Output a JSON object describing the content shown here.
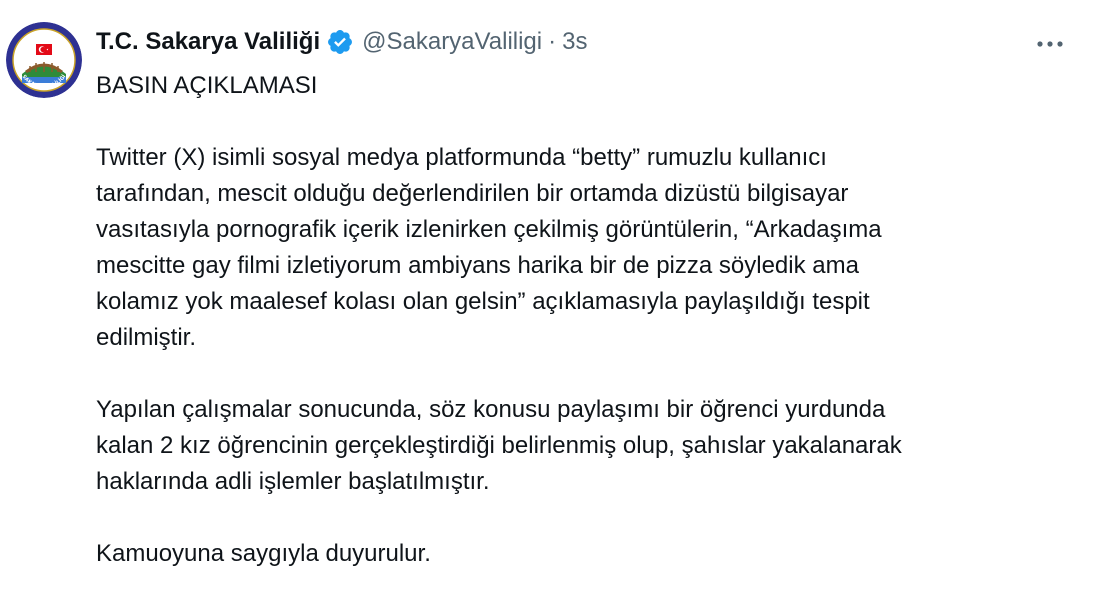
{
  "tweet": {
    "display_name": "T.C. Sakarya Valiliği",
    "handle": "@SakaryaValiligi",
    "separator": "·",
    "time": "3s",
    "avatar_text": {
      "top": "TÜRKİYE CUMHURİYETİ",
      "bottom": "SAKARYA VALİLİĞİ"
    },
    "paragraphs": {
      "p1": "BASIN AÇIKLAMASI",
      "p2": "Twitter (X) isimli sosyal medya platformunda “betty” rumuzlu kullanıcı\ntarafından, mescit olduğu değerlendirilen bir ortamda dizüstü bilgisayar\nvasıtasıyla pornografik içerik izlenirken çekilmiş görüntülerin, “Arkadaşıma\nmescitte gay filmi izletiyorum ambiyans harika bir de pizza söyledik ama\nkolamız yok maalesef kolası olan gelsin” açıklamasıyla paylaşıldığı tespit\nedilmiştir.",
      "p3": "Yapılan çalışmalar sonucunda, söz konusu paylaşımı bir öğrenci yurdunda\nkalan 2 kız öğrencinin gerçekleştirdiği belirlenmiş olup, şahıslar yakalanarak\nhaklarında adli işlemler başlatılmıştır.",
      "p4": "Kamuoyuna saygıyla duyurulur."
    },
    "icons": {
      "verified": "verified-badge-icon",
      "more": "more-options-icon"
    },
    "colors": {
      "text": "#0f1419",
      "secondary": "#536471",
      "verified": "#1d9bf0",
      "avatar_blue": "#2e3192",
      "flag_red": "#e30a17"
    }
  }
}
